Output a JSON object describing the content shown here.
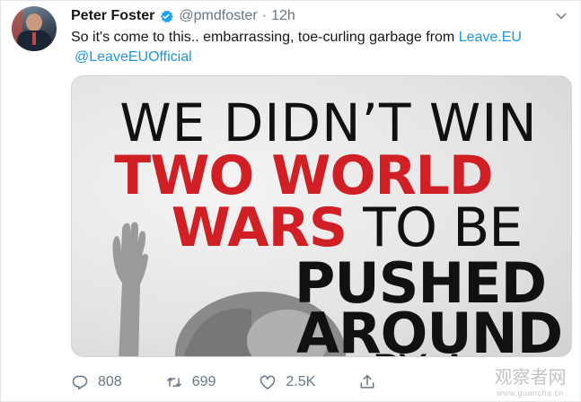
{
  "tweet": {
    "name": "Peter Foster",
    "handle": "@pmdfoster",
    "separator": "·",
    "time": "12h",
    "text_before": "So it's come to this.. embarrassing, toe-curling garbage from ",
    "link1": "Leave.EU",
    "link2": "@LeaveEUOfficial"
  },
  "poster": {
    "line1": "WE DIDN’T WIN",
    "line2": "TWO WORLD",
    "line3_red": "WARS",
    "line3_black": " TO BE",
    "line4": "PUSHED",
    "line5": "AROUND",
    "line6": "BY A"
  },
  "actions": {
    "replies": "808",
    "retweets": "699",
    "likes": "2.5K"
  },
  "watermark": {
    "line1": "观察者网",
    "line2": "www.guancha.cn"
  },
  "colors": {
    "link": "#1b95e0",
    "verified": "#1da1f2",
    "poster_red": "#d11f26"
  },
  "icons": [
    "verified-badge-icon",
    "caret-down-icon",
    "reply-icon",
    "retweet-icon",
    "like-icon",
    "share-icon"
  ]
}
